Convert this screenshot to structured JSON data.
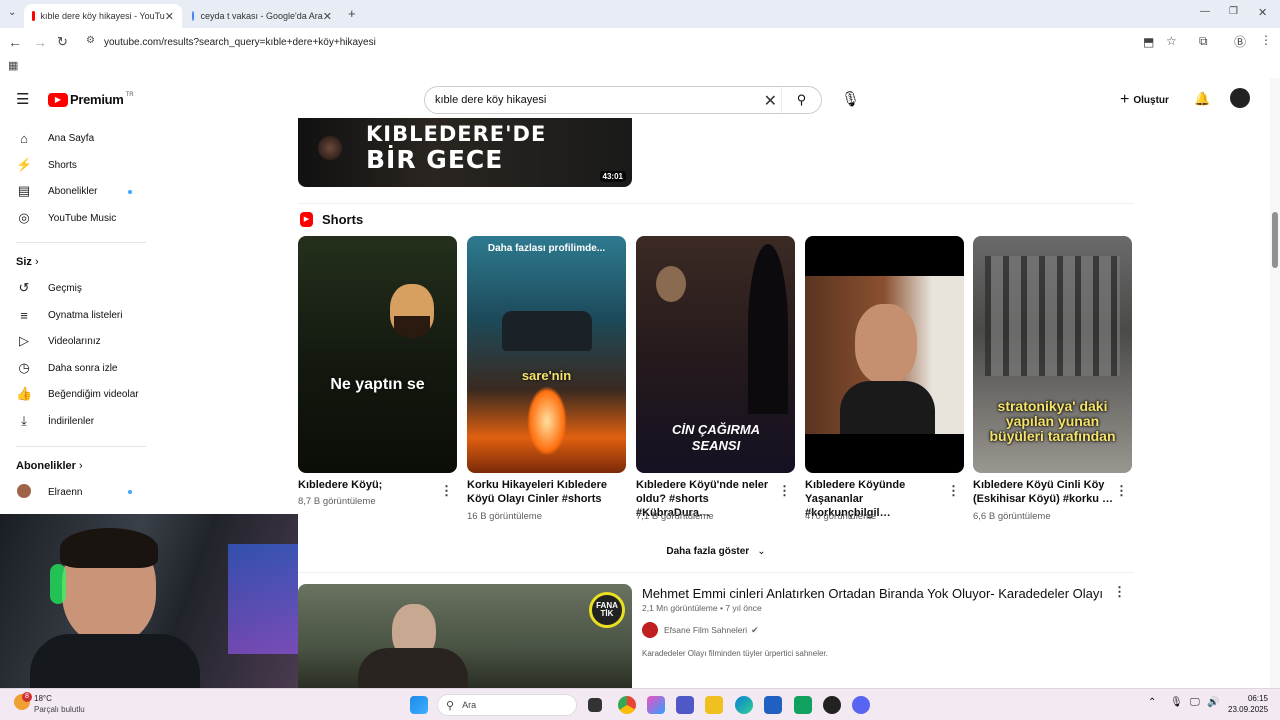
{
  "browser": {
    "tabs": [
      {
        "title": "kıble dere köy hikayesi - YouTu",
        "active": true,
        "favicon_color": "#ff0000"
      },
      {
        "title": "ceyda t vakası - Google'da Ara",
        "active": false,
        "favicon_color": "#4285f4"
      }
    ],
    "url": "youtube.com/results?search_query=kıble+dere+köy+hikayesi"
  },
  "youtube": {
    "logo_text": "Premium",
    "logo_badge": "TR",
    "search_value": "kıble dere köy hikayesi",
    "create_label": "Oluştur"
  },
  "sidebar": {
    "main": [
      {
        "label": "Ana Sayfa",
        "icon": "home-icon"
      },
      {
        "label": "Shorts",
        "icon": "shorts-icon"
      },
      {
        "label": "Abonelikler",
        "icon": "subscriptions-icon",
        "dot": true
      },
      {
        "label": "YouTube Music",
        "icon": "music-icon"
      }
    ],
    "you_heading": "Siz",
    "you": [
      {
        "label": "Geçmiş",
        "icon": "history-icon"
      },
      {
        "label": "Oynatma listeleri",
        "icon": "playlist-icon"
      },
      {
        "label": "Videolarınız",
        "icon": "video-icon"
      },
      {
        "label": "Daha sonra izle",
        "icon": "clock-icon"
      },
      {
        "label": "Beğendiğim videolar",
        "icon": "like-icon"
      },
      {
        "label": "İndirilenler",
        "icon": "download-icon"
      }
    ],
    "subs_heading": "Abonelikler",
    "subs": [
      {
        "label": "Elraenn",
        "dot": true
      }
    ]
  },
  "top_video": {
    "thumb_text_line1": "KIBLEDERE'DE",
    "thumb_text_line2": "BİR GECE",
    "duration": "43:01"
  },
  "shorts": {
    "heading": "Shorts",
    "items": [
      {
        "title": "Kıbledere Köyü;",
        "views": "8,7 B görüntüleme",
        "overlay": "Ne yaptın se",
        "colors": [
          "#1a2414",
          "#0a0d08"
        ]
      },
      {
        "title": "Korku Hikayeleri Kıbledere Köyü Olayı Cinler #shorts",
        "views": "16 B görüntüleme",
        "overlay": "sare'nin",
        "overlay_top": "Daha fazlası profilimde...",
        "colors": [
          "#2a6f86",
          "#e85a10"
        ]
      },
      {
        "title": "Kıbledere Köyü'nde neler oldu? #shorts #KübraDura…",
        "views": "7,1 B görüntüleme",
        "overlay": "CİN ÇAĞIRMA SEANSI",
        "colors": [
          "#3a2a28",
          "#151020"
        ]
      },
      {
        "title": "Kıbledere Köyünde Yaşananlar #korkunçbilgil…",
        "views": "470 görüntüleme",
        "overlay": "",
        "colors": [
          "#6b3a22",
          "#2a2018"
        ]
      },
      {
        "title": "Kıbledere Köyü Cinli Köy (Eskihisar Köyü) #korku …",
        "views": "6,6 B görüntüleme",
        "overlay": "stratonikya' daki yapılan yunan büyüleri tarafından",
        "colors": [
          "#5a5a5a",
          "#8a8680"
        ]
      }
    ],
    "show_more": "Daha fazla göster"
  },
  "video2": {
    "title": "Mehmet Emmi cinleri Anlatırken Ortadan Biranda Yok Oluyor- Karadedeler Olayı",
    "views": "2,1 Mn görüntüleme",
    "age": "7 yıl önce",
    "channel": "Efsane Film Sahneleri",
    "description": "Karadedeler Olayı filminden tüyler ürpertici sahneler.",
    "badge": "FANATİK"
  },
  "taskbar": {
    "temp": "18°C",
    "weather": "Parçalı bulutlu",
    "search": "Ara",
    "time": "06:15",
    "date": "23.09.2025",
    "notif": "8"
  }
}
